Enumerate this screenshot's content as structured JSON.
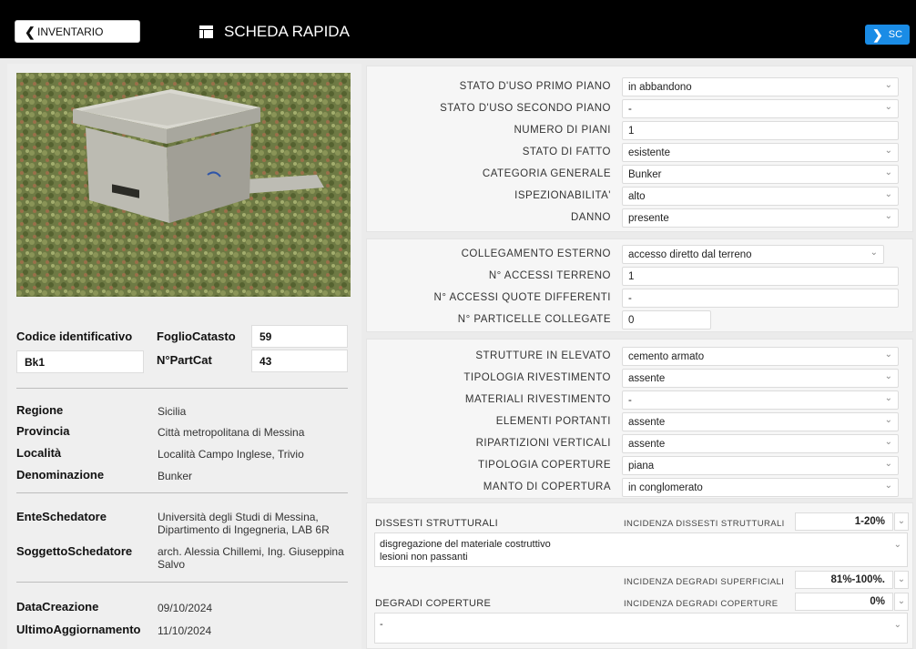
{
  "header": {
    "back_label": "INVENTARIO",
    "title": "SCHEDA RAPIDA",
    "forward_label": "SC"
  },
  "ident": {
    "codice_label": "Codice identificativo",
    "codice_value": "Bk1",
    "foglio_label": "FoglioCatasto",
    "foglio_value": "59",
    "partcat_label": "N°PartCat",
    "partcat_value": "43"
  },
  "location": {
    "regione_label": "Regione",
    "regione_value": "Sicilia",
    "provincia_label": "Provincia",
    "provincia_value": "Città metropolitana di Messina",
    "localita_label": "Località",
    "localita_value": "Località Campo Inglese, Trivio",
    "denominazione_label": "Denominazione",
    "denominazione_value": "Bunker"
  },
  "schedatore": {
    "ente_label": "EnteSchedatore",
    "ente_value": "Università degli Studi di Messina, Dipartimento di Ingegneria, LAB 6R",
    "soggetto_label": "SoggettoSchedatore",
    "soggetto_value": "arch. Alessia Chillemi, Ing. Giuseppina Salvo"
  },
  "dates": {
    "creazione_label": "DataCreazione",
    "creazione_value": "09/10/2024",
    "aggiornamento_label": "UltimoAggiornamento",
    "aggiornamento_value": "11/10/2024"
  },
  "section1": [
    {
      "label": "STATO D'USO PRIMO PIANO",
      "value": "in abbandono",
      "dropdown": true
    },
    {
      "label": "STATO D'USO SECONDO PIANO",
      "value": "-",
      "dropdown": true
    },
    {
      "label": "NUMERO DI PIANI",
      "value": "1",
      "dropdown": false
    },
    {
      "label": "STATO DI FATTO",
      "value": "esistente",
      "dropdown": true
    },
    {
      "label": "CATEGORIA GENERALE",
      "value": "Bunker",
      "dropdown": true
    },
    {
      "label": "ISPEZIONABILITA'",
      "value": "alto",
      "dropdown": true
    },
    {
      "label": "DANNO",
      "value": "presente",
      "dropdown": true
    }
  ],
  "section2": [
    {
      "label": "COLLEGAMENTO ESTERNO",
      "value": "accesso diretto dal terreno",
      "dropdown": true
    },
    {
      "label": "N° ACCESSI TERRENO",
      "value": "1",
      "dropdown": false
    },
    {
      "label": "N° ACCESSI QUOTE DIFFERENTI",
      "value": "-",
      "dropdown": false
    },
    {
      "label": "N° PARTICELLE COLLEGATE",
      "value": "0",
      "dropdown": false
    }
  ],
  "section3": [
    {
      "label": "STRUTTURE IN ELEVATO",
      "value": "cemento armato",
      "dropdown": true
    },
    {
      "label": "TIPOLOGIA RIVESTIMENTO",
      "value": "assente",
      "dropdown": true
    },
    {
      "label": "MATERIALI RIVESTIMENTO",
      "value": "-",
      "dropdown": true
    },
    {
      "label": "ELEMENTI PORTANTI",
      "value": "assente",
      "dropdown": true
    },
    {
      "label": "RIPARTIZIONI VERTICALI",
      "value": "assente",
      "dropdown": true
    },
    {
      "label": "TIPOLOGIA COPERTURE",
      "value": "piana",
      "dropdown": true
    },
    {
      "label": "MANTO DI COPERTURA",
      "value": "in conglomerato",
      "dropdown": true
    }
  ],
  "section4": {
    "dissesti_label": "DISSESTI STRUTTURALI",
    "incidenza_dissesti_label": "INCIDENZA DISSESTI STRUTTURALI",
    "incidenza_dissesti_value": "1-20%",
    "dissesti_lines": [
      "disgregazione del materiale costruttivo",
      "lesioni non passanti"
    ],
    "incidenza_degradi_sup_label": "INCIDENZA DEGRADI SUPERFICIALI",
    "incidenza_degradi_sup_value": "81%-100%.",
    "degradi_coperture_label": "DEGRADI COPERTURE",
    "incidenza_degradi_cop_label": "INCIDENZA DEGRADI COPERTURE",
    "incidenza_degradi_cop_value": "0%",
    "degradi_coperture_text": "-"
  },
  "colors": {
    "topbar": "#000000",
    "accent": "#1a8ce6",
    "panel": "#f6f6f6"
  }
}
